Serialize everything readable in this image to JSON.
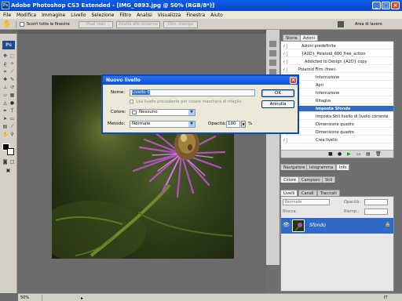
{
  "window": {
    "title": "Adobe Photoshop CS3 Extended - [IMG_0893.jpg @ 50% (RGB/8*)]",
    "app_icon": "Ps"
  },
  "menu": [
    "File",
    "Modifica",
    "Immagine",
    "Livello",
    "Selezione",
    "Filtro",
    "Analisi",
    "Visualizza",
    "Finestra",
    "Aiuto"
  ],
  "options_bar": {
    "checkbox_label": "Scorri tutte le finestre",
    "buttons": [
      "Pixel reali",
      "Adatta allo schermo",
      "Dim. stampa"
    ],
    "workspace": "Area di lavoro"
  },
  "tools": {
    "logo": "Ps"
  },
  "status": {
    "zoom": "50%"
  },
  "history_panel": {
    "tabs": [
      "Storia",
      "Azioni"
    ],
    "active_tab": "Azioni",
    "rows": [
      {
        "check": "✓",
        "label": "Azioni predefinite",
        "selected": false
      },
      {
        "check": "✓",
        "label": "{A2D}_Polaroid_600_free_action",
        "selected": false
      },
      {
        "check": "✓",
        "label": "Addicted to Design {A2D} copy",
        "selected": false
      },
      {
        "check": "✓",
        "label": "Polaroid Film (free)",
        "selected": false
      },
      {
        "check": "✓",
        "label": "Interruzione",
        "selected": false
      },
      {
        "check": "✓",
        "label": "Apri",
        "selected": false
      },
      {
        "check": "✓",
        "label": "Interruzione",
        "selected": false
      },
      {
        "check": "✓",
        "label": "Ritaglia",
        "selected": false
      },
      {
        "check": "✓",
        "label": "Imposta Sfondo",
        "selected": true
      },
      {
        "check": "✓",
        "label": "Imposta Stili livello di livello corrente",
        "selected": false
      },
      {
        "check": "✓",
        "label": "Dimensione quadro",
        "selected": false
      },
      {
        "check": "✓",
        "label": "Dimensione quadro",
        "selected": false
      },
      {
        "check": "✓",
        "label": "Crea livello",
        "selected": false
      }
    ]
  },
  "nav_panel": {
    "tabs": [
      "Navigatore",
      "Istogramma",
      "Info"
    ]
  },
  "color_panel": {
    "tabs": [
      "Colore",
      "Campioni",
      "Stili"
    ]
  },
  "layers_panel": {
    "tabs": [
      "Livelli",
      "Canali",
      "Tracciati"
    ],
    "blend_mode": "Normale",
    "opacity_label": "Opacità:",
    "lock_label": "Blocca:",
    "fill_label": "Riemp.:",
    "layer_name": "Sfondo"
  },
  "dialog": {
    "title": "Nuovo livello",
    "name_label": "Nome:",
    "name_value": "Livello 0",
    "clip_checkbox": "Usa livello precedente per creare maschera di ritaglio",
    "color_label": "Colore:",
    "color_value": "Nessuno",
    "mode_label": "Metodo:",
    "mode_value": "Normale",
    "opacity_label": "Opacità:",
    "opacity_value": "100",
    "opacity_unit": "%",
    "ok": "OK",
    "cancel": "Annulla"
  },
  "taskbar_clock": "IT"
}
